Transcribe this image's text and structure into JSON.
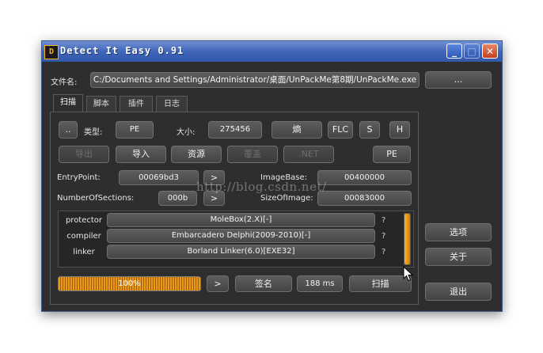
{
  "window": {
    "title": "Detect It Easy 0.91",
    "app_icon_glyph": "D",
    "min_glyph": "_",
    "max_glyph": "□",
    "close_glyph": "✕"
  },
  "file": {
    "label": "文件名:",
    "path": "C:/Documents and Settings/Administrator/桌面/UnPackMe第8期/UnPackMe.exe",
    "browse_label": "..."
  },
  "tabs": [
    "扫描",
    "脚本",
    "插件",
    "日志"
  ],
  "info": {
    "up_button": "..",
    "type_label": "类型:",
    "type_value": "PE",
    "size_label": "大小:",
    "size_value": "275456",
    "entropy_button": "熵",
    "flc_button": "FLC",
    "s_button": "S",
    "h_button": "H"
  },
  "toolbar2": {
    "export": "导出",
    "import": "导入",
    "resources": "资源",
    "overlay": "覆盖",
    "dotnet": ".NET",
    "pe": "PE"
  },
  "pe_fields": {
    "entrypoint_label": "EntryPoint:",
    "entrypoint_value": "00069bd3",
    "imagebase_label": "ImageBase:",
    "imagebase_value": "00400000",
    "sections_label": "NumberOfSections:",
    "sections_value": "000b",
    "sizeofimage_label": "SizeOfImage:",
    "sizeofimage_value": "00083000",
    "more_glyph": ">"
  },
  "detections": [
    {
      "type": "protector",
      "name": "MoleBox(2.X)[-]",
      "q": "?"
    },
    {
      "type": "compiler",
      "name": "Embarcadero Delphi(2009-2010)[-]",
      "q": "?"
    },
    {
      "type": "linker",
      "name": "Borland Linker(6.0)[EXE32]",
      "q": "?"
    }
  ],
  "bottom": {
    "progress_label": "100%",
    "progress_value": 1.0,
    "more_glyph": ">",
    "signature_button": "签名",
    "time": "188 ms",
    "scan_button": "扫描"
  },
  "side": {
    "options": "选项",
    "about": "关于",
    "exit": "退出"
  },
  "watermark": "http://blog.csdn.net/",
  "colors": {
    "accent": "#f0a020",
    "titlebar": "#3d63b6",
    "background": "#2e2e2e"
  }
}
